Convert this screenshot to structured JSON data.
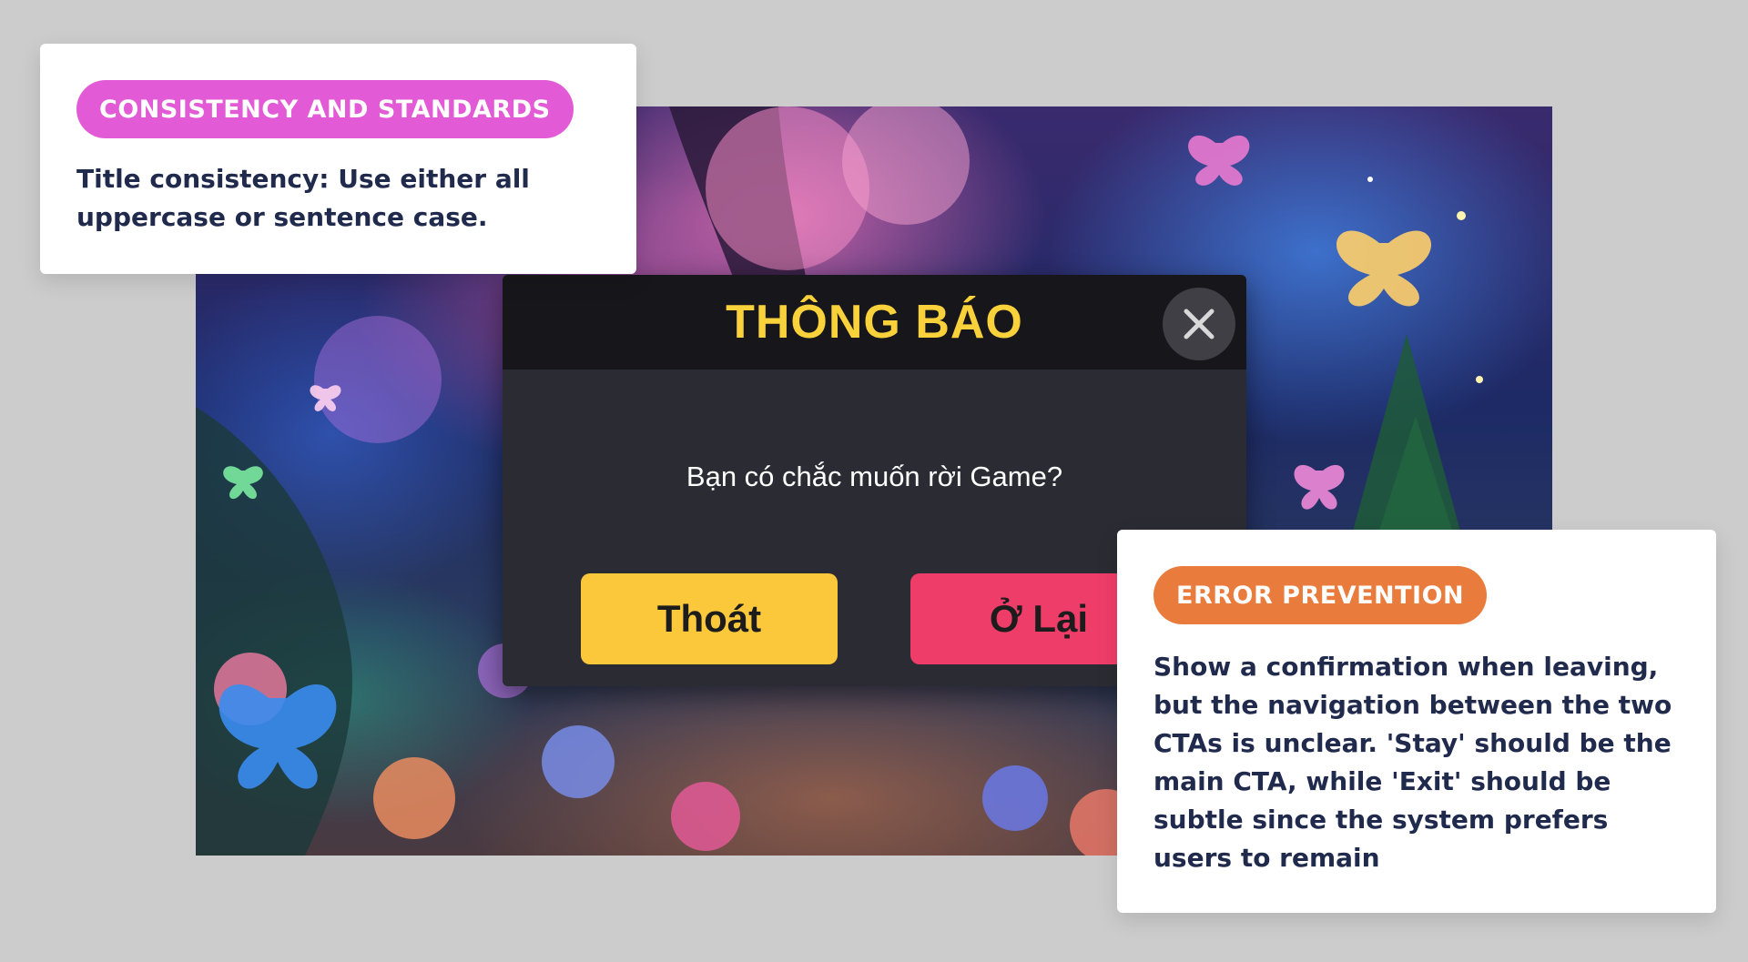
{
  "dialog": {
    "title": "THÔNG BÁO",
    "message": "Bạn có chắc muốn rời Game?",
    "exit_label": "Thoát",
    "stay_label": "Ở Lại",
    "close_icon": "close-icon"
  },
  "annotations": {
    "consistency": {
      "badge": "CONSISTENCY AND STANDARDS",
      "text": "Title consistency: Use either all uppercase or sentence case."
    },
    "error_prevention": {
      "badge": "ERROR PREVENTION",
      "text": "Show a confirmation when leaving, but the navigation between the two CTAs is unclear. 'Stay' should be the main CTA, while 'Exit' should be subtle since the system prefers users to remain"
    }
  },
  "colors": {
    "background": "#cccccc",
    "title_yellow": "#f9d13a",
    "exit_button": "#fbc73b",
    "stay_button": "#ef3d69",
    "consistency_badge": "#e35ad6",
    "error_badge": "#e97b3d",
    "annotation_text": "#202a4d"
  }
}
